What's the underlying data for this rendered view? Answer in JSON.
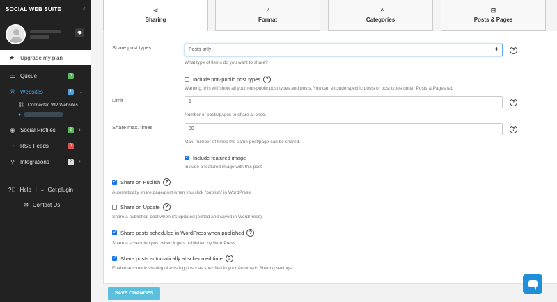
{
  "sidebar": {
    "brand": "SOCIAL WEB SUITE",
    "upgrade_label": "Upgrade my plan",
    "items": [
      {
        "label": "Queue",
        "badge": "0",
        "badge_color": "#5cb85c"
      },
      {
        "label": "Websites",
        "badge": "1",
        "badge_color": "#4aa3df"
      },
      {
        "label": "Social Profiles",
        "badge": "2",
        "badge_color": "#5cb85c"
      },
      {
        "label": "RSS Feeds",
        "badge": "0",
        "badge_color": "#d9534f"
      },
      {
        "label": "Integrations",
        "badge": "2",
        "badge_color": "#dddddd"
      }
    ],
    "sub_items": [
      {
        "label": "Connected WP Websites"
      }
    ],
    "help_label": "Help",
    "plugin_label": "Get plugin",
    "contact_label": "Contact Us"
  },
  "tabs": [
    {
      "label": "Sharing",
      "icon": "share-icon"
    },
    {
      "label": "Format",
      "icon": "magic-wand-icon"
    },
    {
      "label": "Categories",
      "icon": "sort-alpha-icon"
    },
    {
      "label": "Posts & Pages",
      "icon": "minus-square-icon"
    }
  ],
  "form": {
    "post_types_label": "Share post types",
    "post_types_value": "Posts only",
    "post_types_help": "What type of items do you want to share?",
    "nonpublic_label": "Include non-public post types",
    "nonpublic_help": "Warning: this will show all your non-public post types and posts. You can exclude specific posts or post types under Posts & Pages tab",
    "limit_label": "Limit",
    "limit_value": "1",
    "limit_help": "Number of posts/pages to share at once.",
    "max_label": "Share max. times",
    "max_value": "30",
    "max_help": "Max. number of times the same post/page can be shared.",
    "featured_label": "Include featured image",
    "featured_help": "Include a featured image with this post.",
    "publish_label": "Share on Publish",
    "publish_help": "Automatically share page/post when you click \"publish\" in WordPress.",
    "update_label": "Share on Update",
    "update_help": "Share a published post when it's updated (edited and saved in WordPress).",
    "scheduled_label": "Share posts scheduled in WordPress when published",
    "scheduled_help": "Share a scheduled post when it gets published by WordPress.",
    "auto_label": "Share posts automatically at scheduled time",
    "auto_help": "Enable automatic sharing of existing posts as specified in your Automatic Sharing settings.",
    "q_mark": "?"
  },
  "footer": {
    "save_label": "SAVE CHANGES"
  },
  "colors": {
    "accent": "#5bc0de",
    "sidebar_bg": "#222222",
    "active": "#4aa3df",
    "checkbox": "#1a73e8"
  }
}
